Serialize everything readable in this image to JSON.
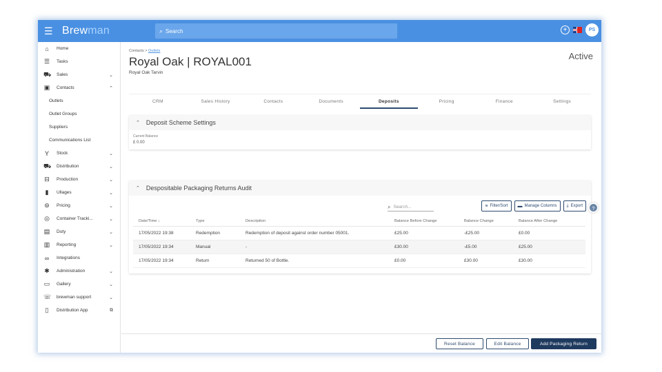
{
  "topbar": {
    "brand_part1": "Brew",
    "brand_part2": "man",
    "search_placeholder": "Search",
    "avatar_initials": "PS"
  },
  "sidebar": {
    "items": [
      {
        "label": "Home",
        "icon": "home-icon",
        "glyph": "⌂"
      },
      {
        "label": "Tasks",
        "icon": "list-icon",
        "glyph": "☰"
      },
      {
        "label": "Sales",
        "icon": "basket-icon",
        "glyph": "⛟",
        "chevron": "⌄"
      },
      {
        "label": "Contacts",
        "icon": "contact-card-icon",
        "glyph": "▣",
        "chevron": "⌃"
      },
      {
        "label": "Outlets",
        "sub": true
      },
      {
        "label": "Outlet Groups",
        "sub": true
      },
      {
        "label": "Suppliers",
        "sub": true
      },
      {
        "label": "Communications List",
        "sub": true
      },
      {
        "label": "Stock",
        "icon": "funnel-icon",
        "glyph": "Y",
        "chevron": "⌄"
      },
      {
        "label": "Distribution",
        "icon": "truck-icon",
        "glyph": "⛟",
        "chevron": "⌄"
      },
      {
        "label": "Production",
        "icon": "production-icon",
        "glyph": "⊟",
        "chevron": "⌄"
      },
      {
        "label": "Ullages",
        "icon": "bottle-icon",
        "glyph": "▮",
        "chevron": "⌄"
      },
      {
        "label": "Pricing",
        "icon": "price-tag-icon",
        "glyph": "⊜",
        "chevron": "⌄"
      },
      {
        "label": "Container Tracki...",
        "icon": "target-icon",
        "glyph": "◎",
        "chevron": "⌄"
      },
      {
        "label": "Duty",
        "icon": "document-icon",
        "glyph": "▤",
        "chevron": "⌄"
      },
      {
        "label": "Reporting",
        "icon": "report-icon",
        "glyph": "▥",
        "chevron": "⌄"
      },
      {
        "label": "Integrations",
        "icon": "link-icon",
        "glyph": "∞"
      },
      {
        "label": "Administration",
        "icon": "gear-icon",
        "glyph": "✱",
        "chevron": "⌄"
      },
      {
        "label": "Gallery",
        "icon": "gallery-icon",
        "glyph": "▭",
        "chevron": "⌄"
      },
      {
        "label": "brewman support",
        "icon": "support-icon",
        "glyph": "☏",
        "chevron": "⌄"
      },
      {
        "label": "Distribution App",
        "icon": "mobile-icon",
        "glyph": "▯",
        "chevron": "⧉"
      }
    ]
  },
  "header": {
    "breadcrumb_root": "Contacts",
    "breadcrumb_sep": " > ",
    "breadcrumb_link": "Outlets",
    "title": "Royal Oak | ROYAL001",
    "subtitle": "Royal Oak Tarvin",
    "status": "Active"
  },
  "tabs": [
    {
      "label": "CRM",
      "active": false
    },
    {
      "label": "Sales History",
      "active": false
    },
    {
      "label": "Contacts",
      "active": false
    },
    {
      "label": "Documents",
      "active": false
    },
    {
      "label": "Deposits",
      "active": true
    },
    {
      "label": "Pricing",
      "active": false
    },
    {
      "label": "Finance",
      "active": false
    },
    {
      "label": "Settings",
      "active": false
    }
  ],
  "deposit_settings": {
    "heading": "Deposit Scheme Settings",
    "current_balance_label": "Current Balance",
    "current_balance_value": "£ 0.00"
  },
  "audit": {
    "heading": "Despositable Packaging Returns Audit",
    "search_placeholder": "Search...",
    "filter_label": "Filter/Sort",
    "manage_columns_label": "Manage Columns",
    "export_label": "Export",
    "columns": [
      "Date/Time ↓",
      "Type",
      "Description",
      "Balance Before Change",
      "Balance Change",
      "Balance After Change"
    ],
    "rows": [
      [
        "17/05/2022 19:38",
        "Redemption",
        "Redemption of deposit against order number 05001.",
        "£25.00",
        "-£25.00",
        "£0.00"
      ],
      [
        "17/05/2022 19:34",
        "Manual",
        "-",
        "£30.00",
        "-£5.00",
        "£25.00"
      ],
      [
        "17/05/2022 19:34",
        "Return",
        "Returned 50 of Bottle.",
        "£0.00",
        "£30.00",
        "£30.00"
      ]
    ]
  },
  "footer": {
    "reset_balance": "Reset Balance",
    "edit_balance": "Edit Balance",
    "add_packaging_return": "Add Packaging Return"
  }
}
